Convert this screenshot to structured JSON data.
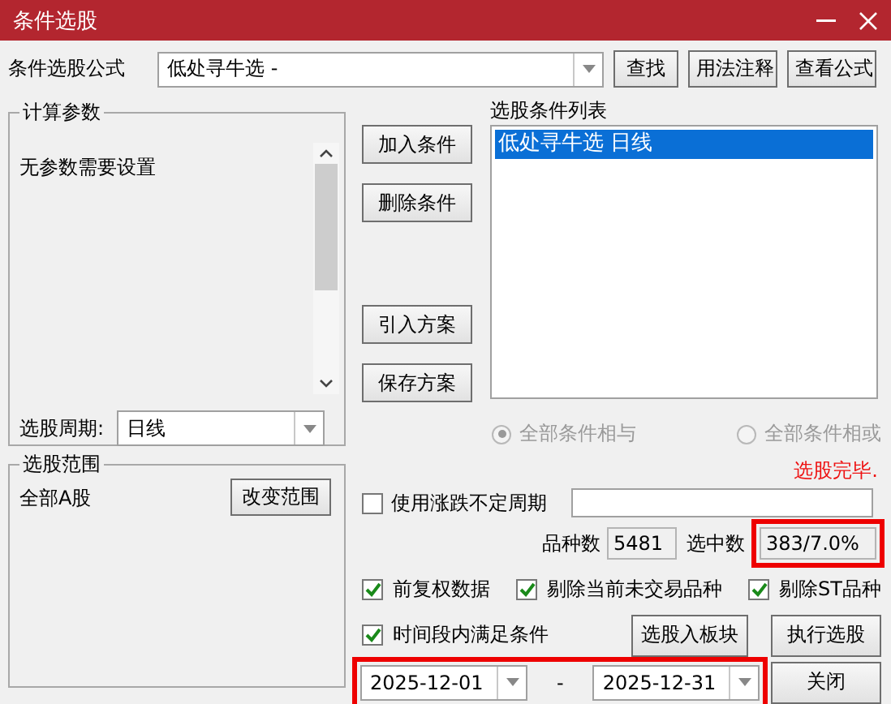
{
  "window": {
    "title": "条件选股"
  },
  "formula": {
    "label": "条件选股公式",
    "value": "低处寻牛选  -",
    "buttons": [
      "查找",
      "用法注释",
      "查看公式"
    ]
  },
  "params_group": {
    "title": "计算参数",
    "message": "无参数需要设置",
    "period_label": "选股周期:",
    "period_value": "日线"
  },
  "scope_group": {
    "title": "选股范围",
    "value": "全部A股",
    "button": "改变范围"
  },
  "action_buttons": [
    "加入条件",
    "删除条件",
    "引入方案",
    "保存方案"
  ],
  "condition_list": {
    "title": "选股条件列表",
    "items": [
      {
        "label": "低处寻牛选  日线",
        "selected": true
      }
    ]
  },
  "logic_options": [
    {
      "label": "全部条件相与",
      "selected": true,
      "disabled": true
    },
    {
      "label": "全部条件相或",
      "selected": false,
      "disabled": true
    }
  ],
  "status": "选股完毕.",
  "variable_period": {
    "label": "使用涨跌不定周期",
    "checked": false
  },
  "counts": {
    "total_label": "品种数",
    "total": "5481",
    "selected_label": "选中数",
    "selected": "383/7.0%",
    "highlighted": true
  },
  "options": [
    {
      "label": "前复权数据",
      "checked": true
    },
    {
      "label": "剔除当前未交易品种",
      "checked": true
    },
    {
      "label": "剔除ST品种",
      "checked": true
    }
  ],
  "time_condition": {
    "label": "时间段内满足条件",
    "checked": true
  },
  "date_range": {
    "start": "2025-12-01",
    "separator": "-",
    "end": "2025-12-31",
    "highlighted": true
  },
  "buttons": {
    "to_block": "选股入板块",
    "run": "执行选股",
    "close": "关闭"
  }
}
